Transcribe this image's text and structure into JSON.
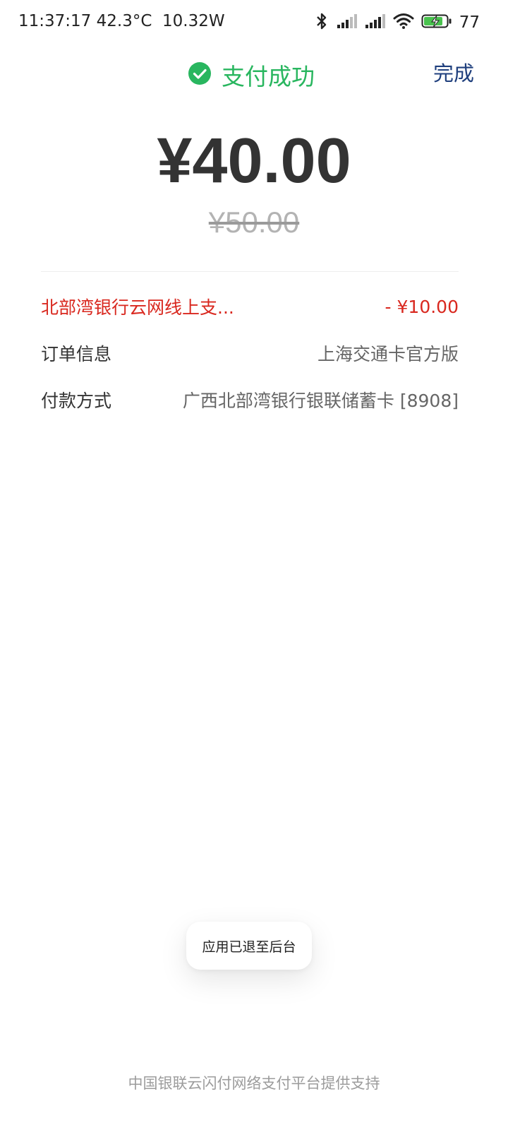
{
  "status_bar": {
    "time": "11:37:17",
    "temperature": "42.3°C",
    "power": "10.32W",
    "battery_percent": "77",
    "icons": [
      "bluetooth-icon",
      "signal-icon",
      "signal-icon",
      "wifi-icon",
      "battery-charging-icon"
    ]
  },
  "header": {
    "status_icon": "check-circle-icon",
    "title": "支付成功",
    "done_label": "完成"
  },
  "amount": {
    "paid": "¥40.00",
    "original": "¥50.00"
  },
  "details": {
    "discount": {
      "label": "北部湾银行云网线上支...",
      "value": "- ¥10.00"
    },
    "order": {
      "label": "订单信息",
      "value": "上海交通卡官方版"
    },
    "payment": {
      "label": "付款方式",
      "value": "广西北部湾银行银联储蓄卡 [8908]"
    }
  },
  "toast": {
    "message": "应用已退至后台"
  },
  "footer": {
    "text": "中国银联云闪付网络支付平台提供支持"
  },
  "colors": {
    "success": "#29b65f",
    "link": "#1f3f7d",
    "discount": "#d9281f",
    "text_primary": "#333333",
    "text_secondary": "#666666",
    "footer": "#9c9c9c"
  }
}
